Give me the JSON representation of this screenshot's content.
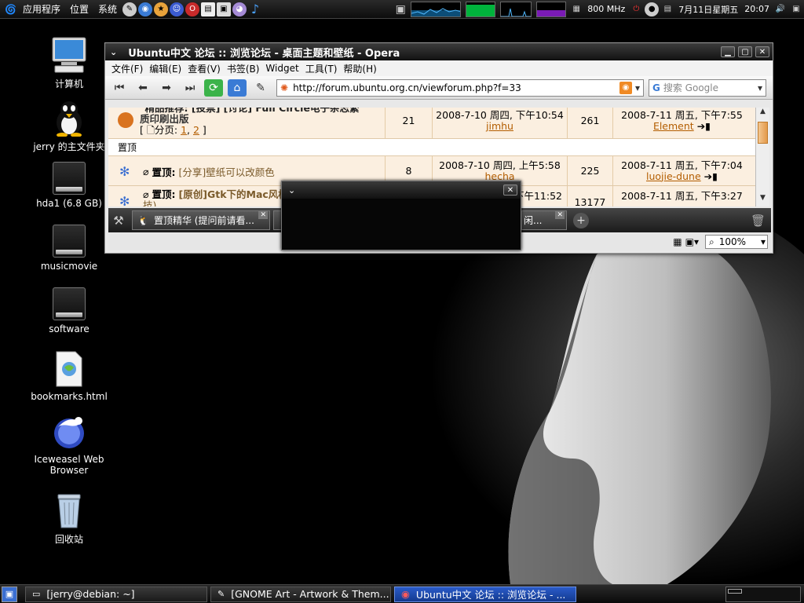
{
  "top_panel": {
    "menus": [
      "应用程序",
      "位置",
      "系统"
    ],
    "cpu_freq": "800 MHz",
    "datetime_date": "7月11日星期五",
    "datetime_time": "20:07"
  },
  "desktop_icons": [
    {
      "label": "计算机",
      "icon": "computer-icon"
    },
    {
      "label": "jerry 的主文件夹",
      "icon": "home-folder-icon"
    },
    {
      "label": "hda1 (6.8 GB)",
      "icon": "drive-icon"
    },
    {
      "label": "musicmovie",
      "icon": "drive-icon"
    },
    {
      "label": "software",
      "icon": "drive-icon"
    },
    {
      "label": "bookmarks.html",
      "icon": "html-file-icon"
    },
    {
      "label": "Iceweasel Web Browser",
      "icon": "iceweasel-icon"
    },
    {
      "label": "回收站",
      "icon": "trash-icon"
    }
  ],
  "opera": {
    "title": "Ubuntu中文 论坛 :: 浏览论坛 - 桌面主题和壁纸 - Opera",
    "menu": [
      "文件(F)",
      "编辑(E)",
      "查看(V)",
      "书签(B)",
      "Widget",
      "工具(T)",
      "帮助(H)"
    ],
    "url": "http://forum.ubuntu.org.cn/viewforum.php?f=33",
    "search_placeholder": "搜索 Google",
    "zoom": "100%",
    "rows": [
      {
        "title_top": "\"精品推荐: [投票] [讨论] Full Circle电子杂志繁",
        "title": "质印刷出版",
        "pages_prefix": "[ 🗋分页: ",
        "page1": "1",
        "sep": ", ",
        "page2": "2",
        "pages_suffix": " ]",
        "replies": "21",
        "posted": "2008-7-10 周四, 下午10:54",
        "author": "jimhu",
        "views": "261",
        "last_post": "2008-7-11 周五, 下午7:55",
        "last_author": "Element"
      },
      {
        "section": "置顶"
      },
      {
        "prefix": "置顶:",
        "title": "[分享]壁纸可以改颜色",
        "replies": "8",
        "posted": "2008-7-10 周四, 上午5:58",
        "author": "hecha",
        "views": "225",
        "last_post": "2008-7-11 周五, 下午7:04",
        "last_author": "luojie-dune"
      },
      {
        "prefix": "置顶:",
        "title": "[原创]Gtk下的Mac风格",
        "title_cont": "技)",
        "posted": "下午11:52",
        "views": "13177",
        "last_post": "2008-7-11 周五, 下午3:27"
      }
    ],
    "tabs": [
      {
        "label": "置顶精华 (提问前请看..."
      },
      {
        "label": "闲..."
      }
    ]
  },
  "taskbar": [
    {
      "label": "[jerry@debian: ~]",
      "active": false
    },
    {
      "label": "[GNOME Art - Artwork & Them...",
      "active": false
    },
    {
      "label": "Ubuntu中文 论坛 :: 浏览论坛 - ...",
      "active": true
    }
  ]
}
